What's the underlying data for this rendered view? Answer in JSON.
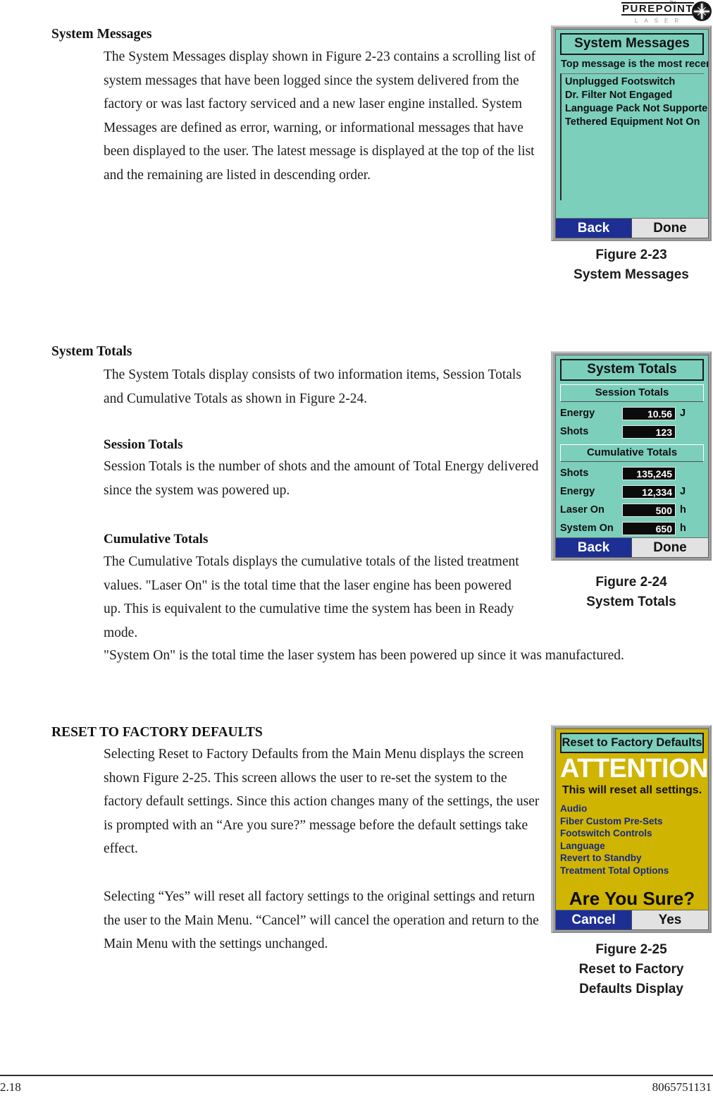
{
  "header": {
    "brand_primary": "PUREPOINT",
    "brand_secondary": "LASER",
    "trademark": "TM"
  },
  "sections": [
    {
      "heading": "System Messages",
      "paragraph": "The System Messages display shown in Figure 2-23 contains a scrolling list of system messages that have been logged since the system delivered from the factory or was last factory serviced and a new laser engine installed. System Messages are defined as error, warning, or informational messages that have been displayed to the user. The latest message is displayed at the top of the list and the remaining are listed in descending order."
    },
    {
      "heading": "System Totals",
      "paragraph": "The System Totals display consists of two information items, Session Totals and Cumulative Totals as shown in Figure 2-24.",
      "sub_heading_1": "Session Totals",
      "sub_paragraph_1": "Session Totals is the number of shots and the amount of Total Energy delivered since the system was powered up.",
      "sub_heading_2": "Cumulative Totals",
      "sub_paragraph_2a": "The Cumulative Totals displays the cumulative totals of the listed treatment values. \"Laser On\" is the total time that the laser engine has been powered up. This is equivalent to the cumulative time the system has been in Ready mode.",
      "sub_paragraph_2b": "\"System On\" is the total time the laser system has been powered up since it was manufactured."
    },
    {
      "heading": "RESET TO FACTORY DEFAULTS",
      "paragraph_1": "Selecting Reset to Factory Defaults from the Main Menu displays the screen shown Figure 2-25. This screen allows the user to re-set the system to the factory default settings. Since this action changes many of the settings, the user is prompted with an “Are you sure?” message before the default settings take effect.",
      "paragraph_2": "Selecting “Yes” will reset all factory settings to the original settings and return the user to the Main Menu. “Cancel” will cancel the operation and return to the Main Menu with the settings unchanged."
    }
  ],
  "figure_system_messages": {
    "caption_line_1": "Figure 2-23",
    "caption_line_2": "System Messages",
    "screen": {
      "title": "System Messages",
      "subtitle": "Top message is the most recent",
      "messages": [
        "Unplugged Footswitch",
        "Dr. Filter Not Engaged",
        "Language Pack Not Supported",
        "Tethered Equipment Not On"
      ],
      "button_back": "Back",
      "button_done": "Done"
    }
  },
  "figure_system_totals": {
    "caption_line_1": "Figure 2-24",
    "caption_line_2": "System Totals",
    "screen": {
      "title": "System Totals",
      "session_band": "Session Totals",
      "session_rows": [
        {
          "label": "Energy",
          "value": "10.56",
          "unit": "J"
        },
        {
          "label": "Shots",
          "value": "123",
          "unit": ""
        }
      ],
      "cumulative_band": "Cumulative Totals",
      "cumulative_rows": [
        {
          "label": "Shots",
          "value": "135,245",
          "unit": ""
        },
        {
          "label": "Energy",
          "value": "12,334",
          "unit": "J"
        },
        {
          "label": "Laser On",
          "value": "500",
          "unit": "h"
        },
        {
          "label": "System On",
          "value": "650",
          "unit": "h"
        }
      ],
      "button_back": "Back",
      "button_done": "Done"
    }
  },
  "figure_reset_defaults": {
    "caption_line_1": "Figure 2-25",
    "caption_line_2": "Reset to Factory",
    "caption_line_3": "Defaults Display",
    "screen": {
      "title": "Reset to Factory Defaults",
      "attention": "ATTENTION",
      "warning": "This will reset all settings.",
      "items": [
        "Audio",
        "Fiber Custom Pre-Sets",
        "Footswitch Controls",
        "Language",
        "Revert to Standby",
        "Treatment Total Options"
      ],
      "confirm_prompt": "Are You Sure?",
      "button_cancel": "Cancel",
      "button_yes": "Yes"
    }
  },
  "footer": {
    "page_number": "2.18",
    "document_number": "8065751131"
  },
  "colors": {
    "lcd_teal": "#7ccfbb",
    "lcd_gold": "#d0b402",
    "button_primary_blue": "#1d2f93",
    "button_secondary_gray": "#e2e2e2",
    "value_field_black": "#0b0b0b",
    "reset_item_blue": "#142a82"
  }
}
